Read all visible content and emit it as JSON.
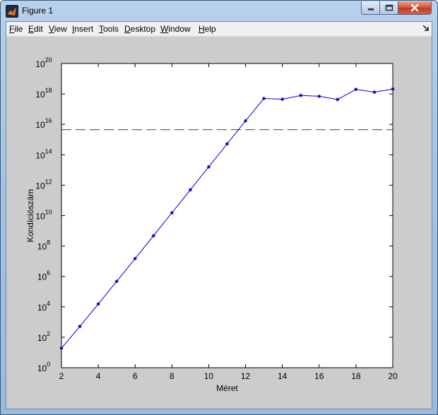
{
  "window": {
    "title": "Figure 1",
    "icon": "matlab-icon"
  },
  "menu": [
    {
      "first": "F",
      "rest": "ile"
    },
    {
      "first": "E",
      "rest": "dit"
    },
    {
      "first": "V",
      "rest": "iew"
    },
    {
      "first": "I",
      "rest": "nsert"
    },
    {
      "first": "T",
      "rest": "ools"
    },
    {
      "first": "D",
      "rest": "esktop"
    },
    {
      "first": "W",
      "rest": "indow"
    },
    {
      "first": "H",
      "rest": "elp"
    }
  ],
  "colors": {
    "series": "#0000cc",
    "reference": "#117a30",
    "axes_bg": "#ffffff",
    "figure_bg": "#cccccc"
  },
  "chart_data": {
    "type": "line",
    "xlabel": "Méret",
    "ylabel": "Kondíciószám",
    "xlim": [
      2,
      20
    ],
    "ylim": [
      1,
      1e+20
    ],
    "yscale": "log",
    "xticks": [
      2,
      4,
      6,
      8,
      10,
      12,
      14,
      16,
      18,
      20
    ],
    "yticks_exponents": [
      0,
      2,
      4,
      6,
      8,
      10,
      12,
      14,
      16,
      18,
      20
    ],
    "ytick_base": "10",
    "grid": false,
    "series": [
      {
        "marker": "*",
        "x": [
          2,
          3,
          4,
          5,
          6,
          7,
          8,
          9,
          10,
          11,
          12,
          13,
          14,
          15,
          16,
          17,
          18,
          19,
          20
        ],
        "y": [
          19.3,
          524,
          15514,
          476607,
          14951059,
          475367357,
          15257575089,
          493153756289,
          16024859712306,
          522794367588501,
          16987539200000000,
          502000000000000000,
          450000000000000000,
          800000000000000000,
          700000000000000000,
          430000000000000000,
          2000000000000000000,
          1300000000000000000,
          2100000000000000000
        ]
      }
    ],
    "reference_line": {
      "y": 4503599627370496,
      "style": "dashed"
    }
  }
}
